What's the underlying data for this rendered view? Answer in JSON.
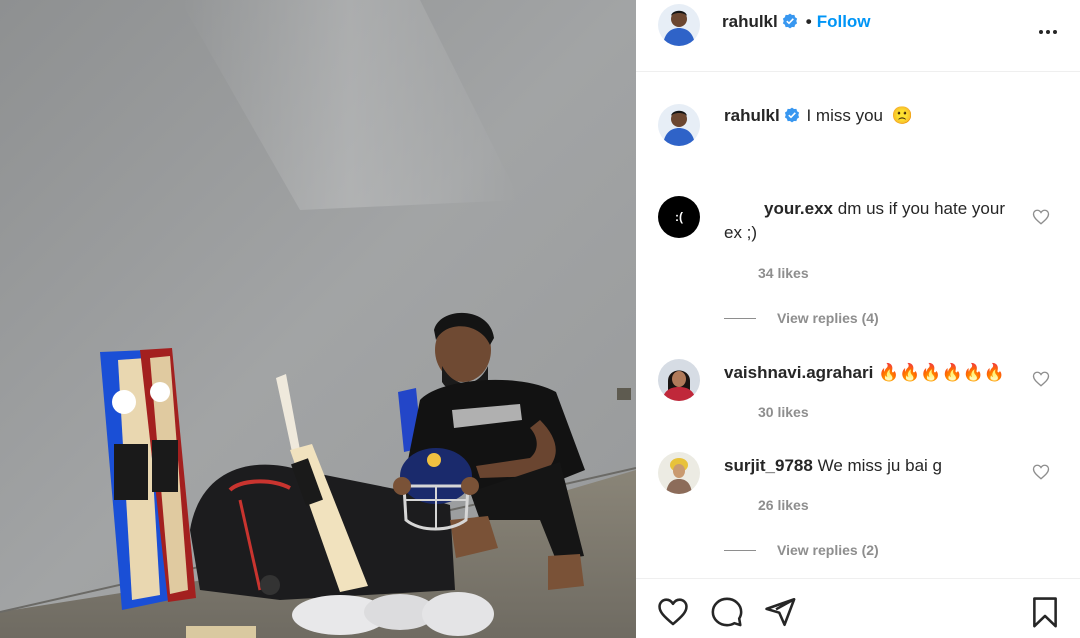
{
  "post_author": {
    "username": "rahulkl",
    "verified": true,
    "follow_label": "Follow",
    "separator": "•"
  },
  "caption": {
    "username": "rahulkl",
    "text": "I miss you",
    "emoji": "🙁"
  },
  "comments": [
    {
      "username": "your.exx",
      "text": "dm us if you hate your ex ;)",
      "avatar_text": ":(",
      "likes": "34 likes",
      "view_replies": "View replies (4)"
    },
    {
      "username": "vaishnavi.agrahari",
      "text": "🔥🔥🔥🔥🔥🔥",
      "likes": "30 likes"
    },
    {
      "username": "surjit_9788",
      "text": "We miss ju bai g",
      "likes": "26 likes",
      "view_replies": "View replies (2)"
    }
  ],
  "icons": {
    "more": "more-options-icon",
    "like": "heart-icon",
    "comment": "comment-icon",
    "share": "paper-plane-icon",
    "save": "bookmark-icon"
  },
  "colors": {
    "follow_blue": "#0095f6",
    "verified_blue": "#3897f0",
    "meta_gray": "#8e8e8e",
    "text": "#262626",
    "fire": "#ff6a00"
  }
}
